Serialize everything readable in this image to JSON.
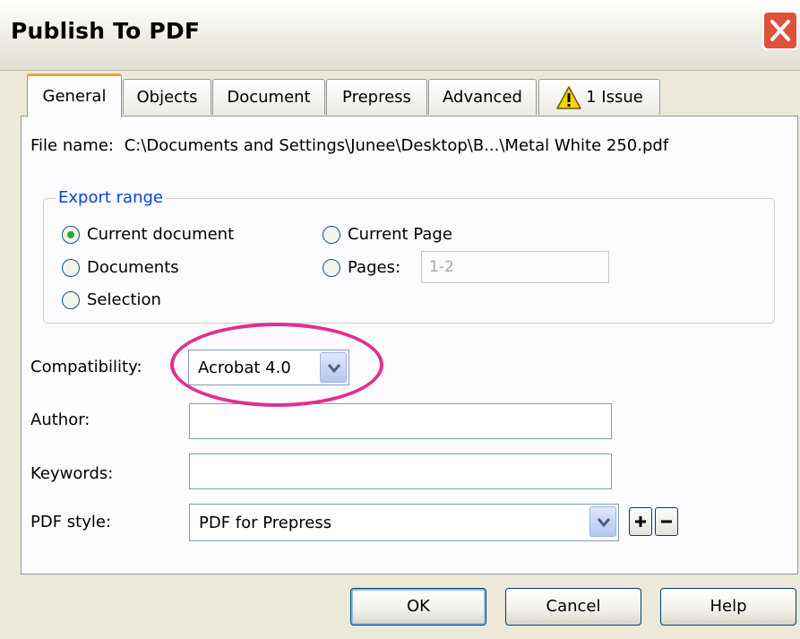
{
  "window": {
    "title": "Publish To PDF"
  },
  "tabs": [
    {
      "label": "General"
    },
    {
      "label": "Objects"
    },
    {
      "label": "Document"
    },
    {
      "label": "Prepress"
    },
    {
      "label": "Advanced"
    },
    {
      "label": "1 Issue",
      "icon": "warning-icon"
    }
  ],
  "general": {
    "file_name_label": "File name:",
    "file_name_value": "C:\\Documents and Settings\\Junee\\Desktop\\B...\\Metal White 250.pdf",
    "export_range": {
      "legend": "Export range",
      "options": {
        "current_document": {
          "label": "Current document",
          "selected": true
        },
        "documents": {
          "label": "Documents",
          "selected": false
        },
        "selection": {
          "label": "Selection",
          "selected": false
        },
        "current_page": {
          "label": "Current Page",
          "selected": false
        },
        "pages": {
          "label": "Pages:",
          "selected": false
        }
      },
      "pages_value": "1-2"
    },
    "compatibility": {
      "label": "Compatibility:",
      "value": "Acrobat 4.0"
    },
    "author": {
      "label": "Author:",
      "value": ""
    },
    "keywords": {
      "label": "Keywords:",
      "value": ""
    },
    "pdf_style": {
      "label": "PDF style:",
      "value": "PDF for Prepress"
    }
  },
  "buttons": {
    "ok": "OK",
    "cancel": "Cancel",
    "help": "Help"
  },
  "colors": {
    "highlight": "#e0308e",
    "active_tab_accent": "#e8a33a",
    "close_button": "#e0503a",
    "legend_text": "#0046d5"
  }
}
